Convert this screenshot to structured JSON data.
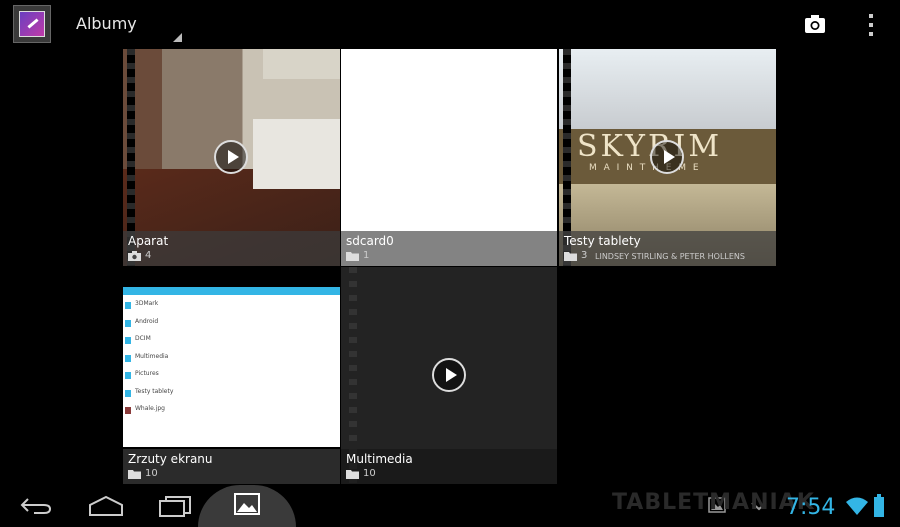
{
  "actionbar": {
    "title": "Albumy"
  },
  "albums": [
    {
      "name": "Aparat",
      "count": "4",
      "source": "camera-icon"
    },
    {
      "name": "sdcard0",
      "count": "1",
      "source": "folder-icon"
    },
    {
      "name": "Testy tablety",
      "count": "3",
      "source": "folder-icon"
    },
    {
      "name": "Zrzuty ekranu",
      "count": "10",
      "source": "folder-icon"
    },
    {
      "name": "Multimedia",
      "count": "10",
      "source": "folder-icon"
    }
  ],
  "skyrim_thumb": {
    "title": "SKYRIM",
    "sub": "M A I N  T H E M E",
    "credit": "LINDSEY STIRLING & PETER HOLLENS"
  },
  "screenshot_thumb": {
    "items": [
      "3DMark",
      "Android",
      "DCIM",
      "Multimedia",
      "Pictures",
      "Testy tablety",
      "Whale.jpg"
    ]
  },
  "statusbar": {
    "time": "7:54",
    "watermark": "TABLETMANIAK"
  },
  "colors": {
    "accent": "#33b5e5",
    "background": "#000000"
  }
}
